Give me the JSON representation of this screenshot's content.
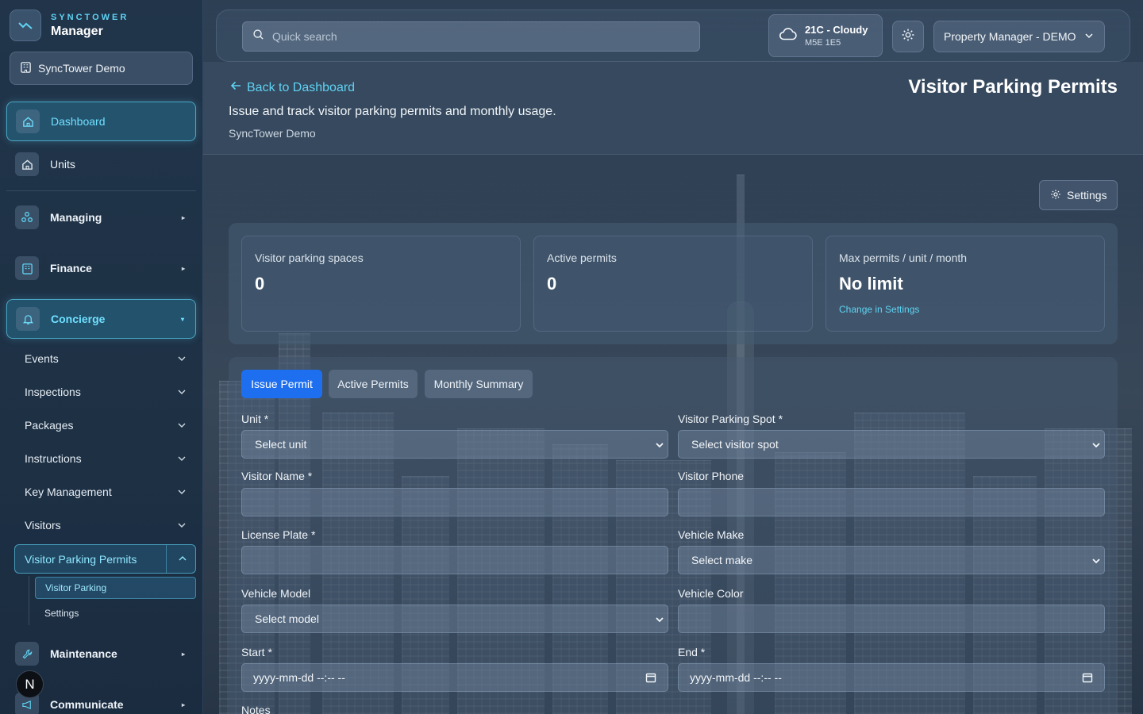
{
  "brand": {
    "small": "SYNCTOWER",
    "big": "Manager"
  },
  "tenant": {
    "label": "SyncTower Demo"
  },
  "sidebar": {
    "dashboard": "Dashboard",
    "units": "Units",
    "managing": "Managing",
    "finance": "Finance",
    "concierge": "Concierge",
    "concierge_items": [
      "Events",
      "Inspections",
      "Packages",
      "Instructions",
      "Key Management",
      "Visitors"
    ],
    "visitor_parking_permits": "Visitor Parking Permits",
    "vpp_items": [
      "Visitor Parking",
      "Settings"
    ],
    "maintenance": "Maintenance",
    "communicate": "Communicate",
    "avatar_letter": "N"
  },
  "topbar": {
    "search_placeholder": "Quick search",
    "weather_main": "21C - Cloudy",
    "weather_postal": "M5E 1E5",
    "role": "Property Manager - DEMO"
  },
  "header": {
    "back": "Back to Dashboard",
    "title": "Visitor Parking Permits",
    "subtitle": "Issue and track visitor parking permits and monthly usage.",
    "org": "SyncTower Demo"
  },
  "settings_button": "Settings",
  "stats": [
    {
      "label": "Visitor parking spaces",
      "value": "0"
    },
    {
      "label": "Active permits",
      "value": "0"
    },
    {
      "label": "Max permits / unit / month",
      "value": "No limit",
      "link": "Change in Settings"
    }
  ],
  "tabs": [
    "Issue Permit",
    "Active Permits",
    "Monthly Summary"
  ],
  "form": {
    "unit_label": "Unit *",
    "unit_value": "Select unit",
    "spot_label": "Visitor Parking Spot *",
    "spot_value": "Select visitor spot",
    "visitor_name_label": "Visitor Name *",
    "visitor_phone_label": "Visitor Phone",
    "plate_label": "License Plate *",
    "make_label": "Vehicle Make",
    "make_value": "Select make",
    "model_label": "Vehicle Model",
    "model_value": "Select model",
    "color_label": "Vehicle Color",
    "start_label": "Start *",
    "start_value": "yyyy-mm-dd --:-- --",
    "end_label": "End *",
    "end_value": "yyyy-mm-dd --:-- --",
    "notes_label": "Notes"
  },
  "colors": {
    "accent": "#5fd3f3",
    "primary_tab": "#1e6ff0"
  }
}
